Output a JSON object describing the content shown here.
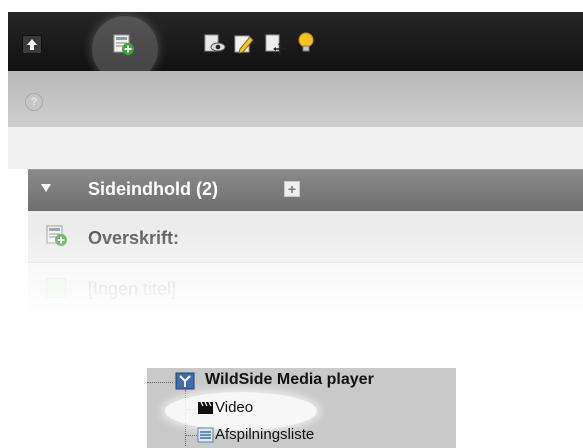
{
  "toolbar": {
    "icons": [
      "go-up-icon",
      "new-content-icon",
      "view-page-icon",
      "edit-page-icon",
      "move-page-icon",
      "hint-bulb-icon"
    ]
  },
  "infobar": {
    "icon": "help-icon"
  },
  "section": {
    "title": "Sideindhold (2)",
    "add_label": "+"
  },
  "rows": [
    {
      "label": "Overskrift:"
    },
    {
      "label": "[Ingen titel]"
    }
  ],
  "tree": {
    "root_label": "WildSide Media player",
    "children": [
      {
        "label": "Video"
      },
      {
        "label": "Afspilningsliste"
      }
    ]
  },
  "colors": {
    "toolbar": "#1c1c1c",
    "infobar": "#c4c4c4",
    "section_header": "#7c7c7c",
    "tree_bg": "#c9c9c9"
  }
}
